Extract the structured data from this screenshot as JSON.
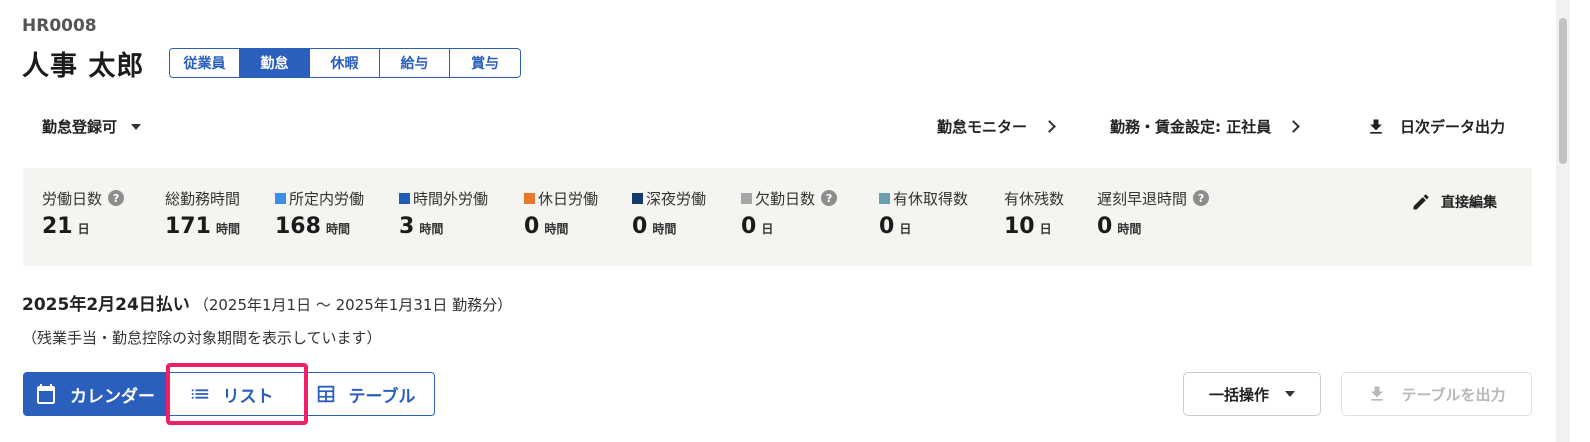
{
  "employee": {
    "code": "HR0008",
    "name": "人事 太郎"
  },
  "tabs": [
    {
      "label": "従業員",
      "active": false
    },
    {
      "label": "勤怠",
      "active": true
    },
    {
      "label": "休暇",
      "active": false
    },
    {
      "label": "給与",
      "active": false
    },
    {
      "label": "賞与",
      "active": false
    }
  ],
  "toolbar": {
    "status_label": "勤怠登録可",
    "monitor_label": "勤怠モニター",
    "settings_label": "勤務・賃金設定: 正社員",
    "daily_export_label": "日次データ出力"
  },
  "summary": {
    "stats": [
      {
        "label": "労働日数",
        "value": "21",
        "unit": "日",
        "help": "?",
        "swatch": ""
      },
      {
        "label": "総勤務時間",
        "value": "171",
        "unit": "時間",
        "swatch": ""
      },
      {
        "label": "所定内労働",
        "value": "168",
        "unit": "時間",
        "swatch": "#3a8ee6"
      },
      {
        "label": "時間外労働",
        "value": "3",
        "unit": "時間",
        "swatch": "#1f5cb8"
      },
      {
        "label": "休日労働",
        "value": "0",
        "unit": "時間",
        "swatch": "#e8772e"
      },
      {
        "label": "深夜労働",
        "value": "0",
        "unit": "時間",
        "swatch": "#123a6b"
      },
      {
        "label": "欠勤日数",
        "value": "0",
        "unit": "日",
        "help": "?",
        "swatch": "#a6a6a6"
      },
      {
        "label": "有休取得数",
        "value": "0",
        "unit": "日",
        "swatch": "#6a9fb0"
      },
      {
        "label": "有休残数",
        "value": "10",
        "unit": "日",
        "swatch": ""
      },
      {
        "label": "遅刻早退時間",
        "value": "0",
        "unit": "時間",
        "help": "?",
        "swatch": ""
      }
    ],
    "edit_label": "直接編集"
  },
  "period": {
    "title": "2025年2月24日払い",
    "range": "（2025年1月1日 ～ 2025年1月31日 勤務分）",
    "note": "（残業手当・勤怠控除の対象期間を表示しています）"
  },
  "view_toggle": {
    "calendar_label": "カレンダー",
    "list_label": "リスト",
    "table_label": "テーブル"
  },
  "actions": {
    "bulk_label": "一括操作",
    "export_table_label": "テーブルを出力"
  },
  "colors": {
    "accent": "#2b5fbe",
    "highlight": "#ef1f6a",
    "summary_bg": "#f5f4f0"
  }
}
